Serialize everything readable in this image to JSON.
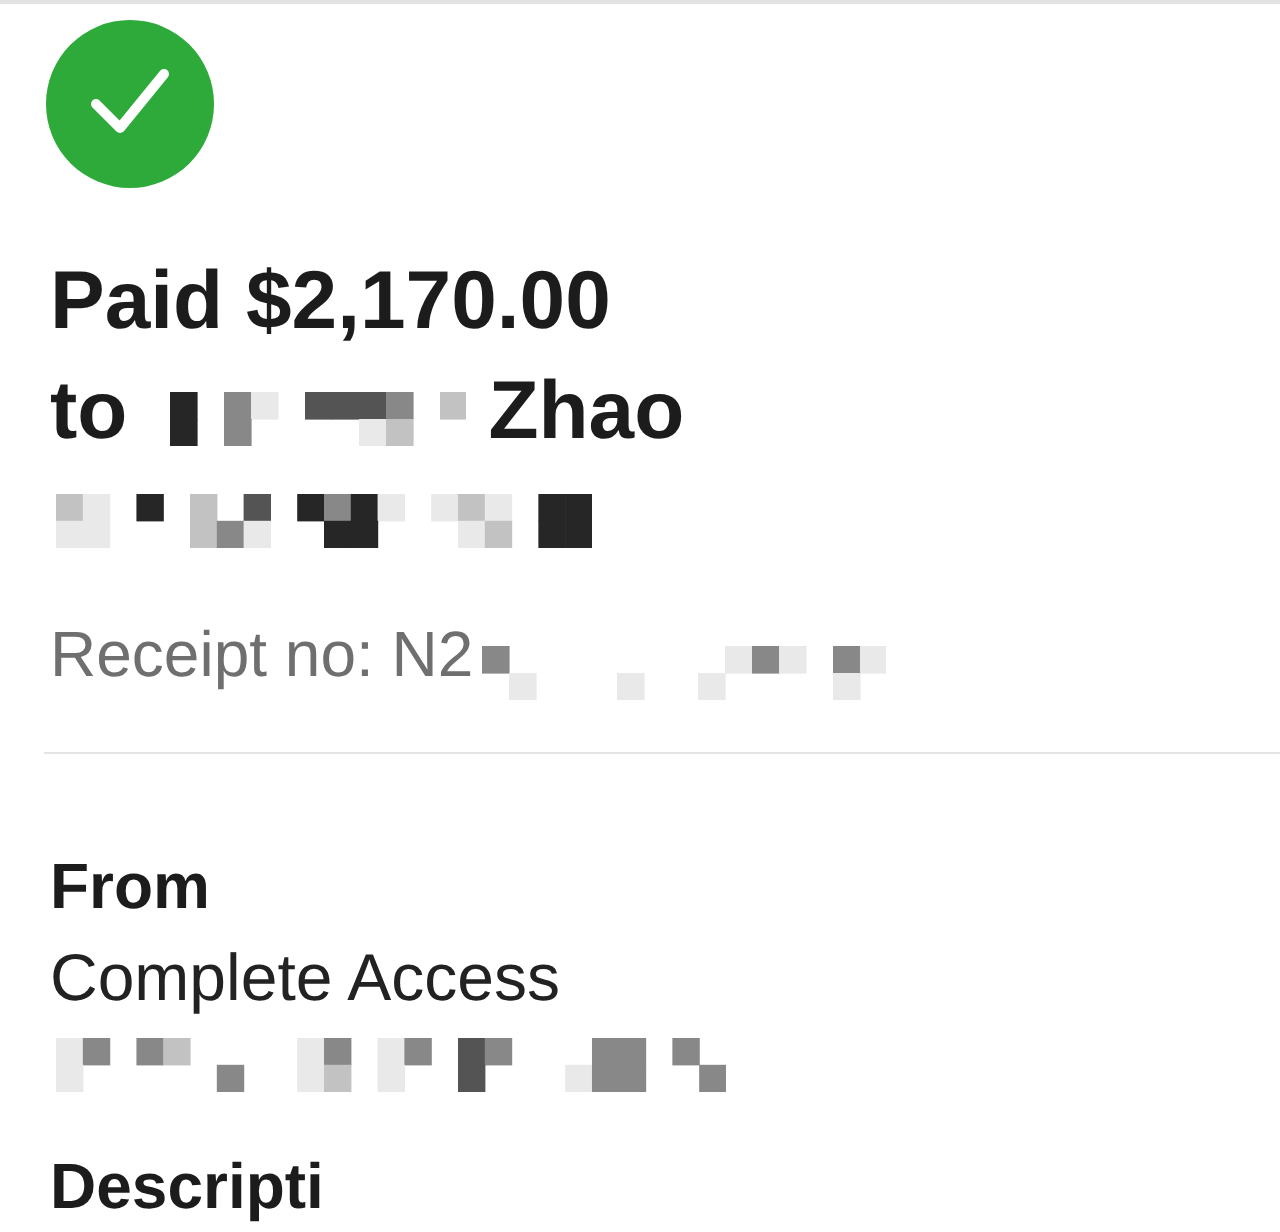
{
  "status_icon": {
    "kind": "success"
  },
  "payment": {
    "title": "Paid $2,170.00",
    "recipient": {
      "prefix": "to",
      "redacted": true,
      "suffix": "Zhao"
    },
    "detail": {
      "redacted": true
    },
    "receipt": {
      "label": "Receipt no: N2",
      "redacted": true
    }
  },
  "sections": [
    {
      "heading": "From",
      "lines": [
        {
          "kind": "text",
          "text": "Complete Access"
        },
        {
          "kind": "redacted"
        }
      ]
    },
    {
      "heading": "Descripti"
    }
  ]
}
